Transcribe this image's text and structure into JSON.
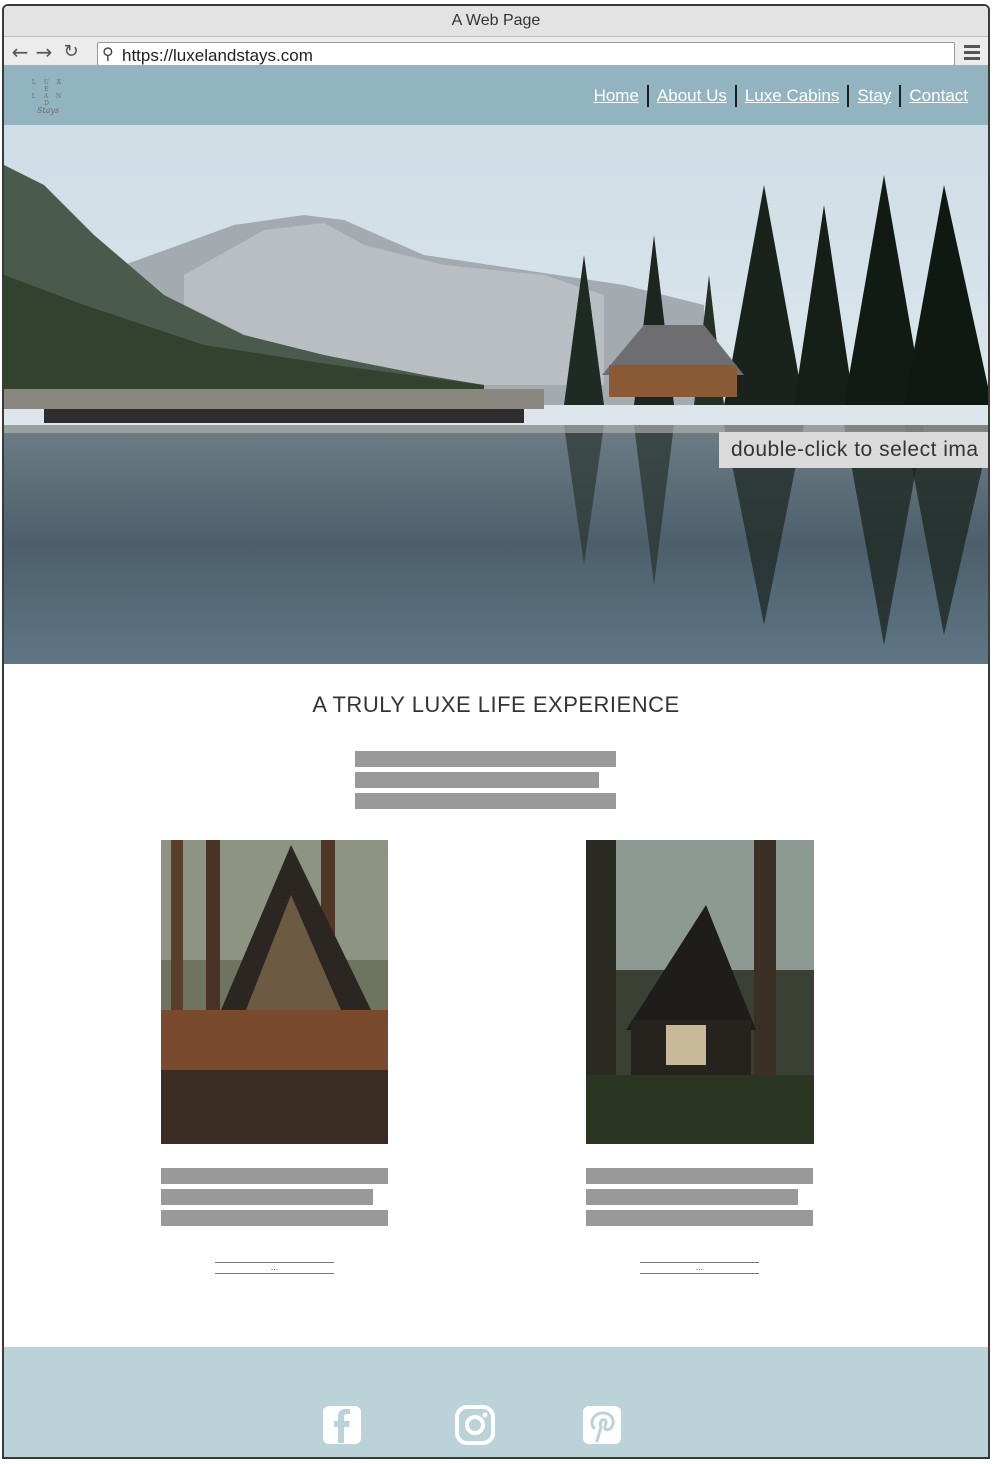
{
  "browser": {
    "window_title": "A Web Page",
    "url": "https://luxelandstays.com",
    "back_icon": "arrow-left-icon",
    "forward_icon": "arrow-right-icon",
    "reload_icon": "reload-icon",
    "menu_icon": "hamburger-menu-icon"
  },
  "header": {
    "logo_line1": "L U X E",
    "logo_line2": "L A N D",
    "logo_script": "Stays",
    "nav": [
      "Home",
      "About Us",
      "Luxe Cabins",
      "Stay",
      "Contact"
    ],
    "bg_color": "#92b4c0"
  },
  "hero": {
    "image": "mountain-lake-lodge-photo",
    "overlay_hint": "double-click to select ima"
  },
  "main": {
    "tagline": "A TRULY LUXE LIFE EXPERIENCE",
    "cards": [
      {
        "image": "a-frame-cabin-forest-photo",
        "more_label": "..."
      },
      {
        "image": "dark-a-frame-cabin-night-photo",
        "more_label": "..."
      }
    ]
  },
  "footer": {
    "social": [
      "facebook-icon",
      "instagram-icon",
      "pinterest-icon"
    ],
    "bg_color": "#bcd2d9"
  }
}
